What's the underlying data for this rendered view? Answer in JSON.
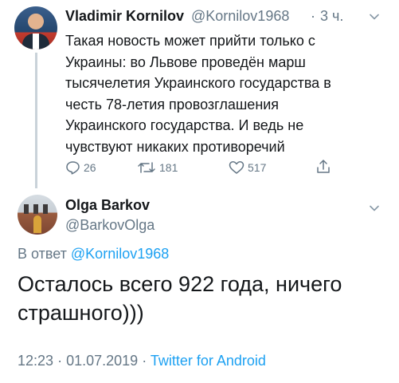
{
  "tweet1": {
    "name": "Vladimir Kornilov",
    "handle": "@Kornilov1968",
    "separator": "·",
    "time": "3 ч.",
    "lines": [
      "Такая новость может прийти только с",
      "Украины: во Львове проведён марш",
      "тысячелетия Украинского государства в",
      "честь 78-летия провозглашения",
      "Украинского государства. И ведь не",
      "чувствуют никаких противоречий"
    ],
    "actions": {
      "reply_count": "26",
      "retweet_count": "181",
      "like_count": "517"
    },
    "icons": {
      "reply": "reply-icon",
      "retweet": "retweet-icon",
      "like": "heart-icon",
      "share": "share-icon",
      "menu": "chevron-down-icon"
    }
  },
  "tweet2": {
    "name": "Olga Barkov",
    "handle": "@BarkovOlga",
    "reply_prefix": "В ответ",
    "reply_mention": "@Kornilov1968",
    "text_lines": [
      "Осталось всего 922 года, ничего",
      "страшного)))"
    ],
    "time": "12:23",
    "date": "01.07.2019",
    "meta_separator": "·",
    "client": "Twitter for Android"
  },
  "colors": {
    "text": "#14171a",
    "secondary": "#657786",
    "accent": "#1da1f2",
    "thread_line": "#c9d2d9"
  }
}
